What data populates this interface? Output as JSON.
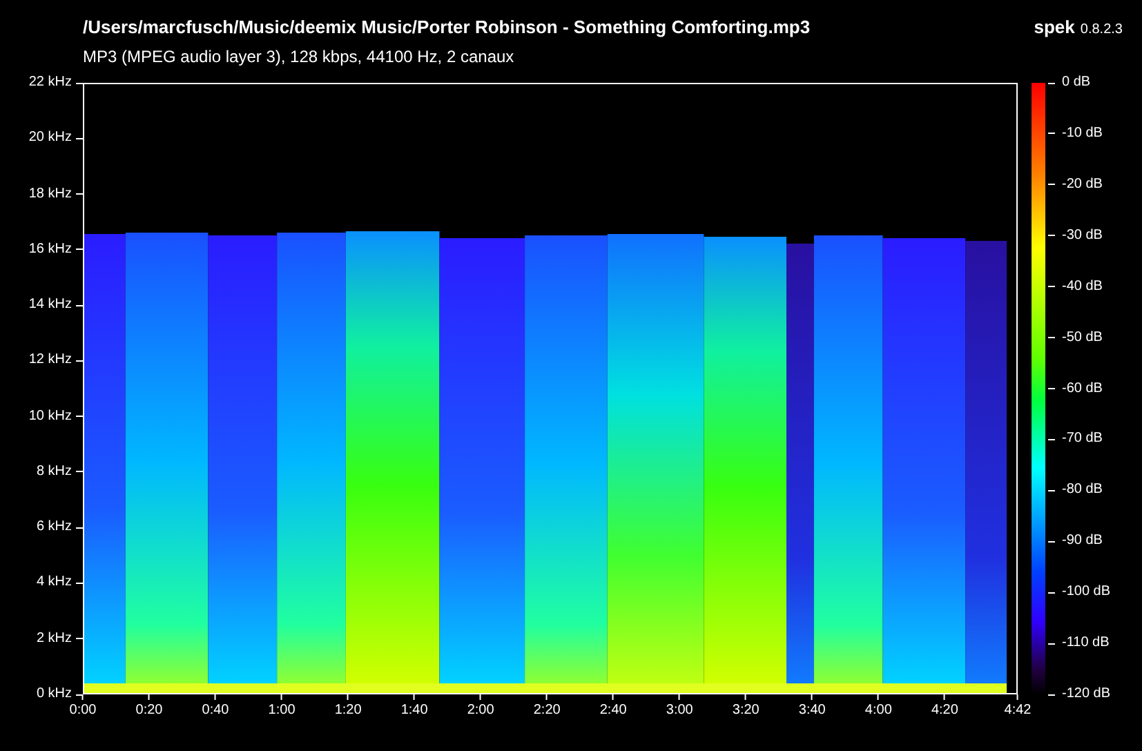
{
  "header": {
    "title": "/Users/marcfusch/Music/deemix Music/Porter Robinson - Something Comforting.mp3",
    "subtitle": "MP3 (MPEG audio layer 3), 128 kbps, 44100 Hz, 2 canaux",
    "brand": "spek",
    "version": "0.8.2.3"
  },
  "y_axis": {
    "ticks": [
      "22 kHz",
      "20 kHz",
      "18 kHz",
      "16 kHz",
      "14 kHz",
      "12 kHz",
      "10 kHz",
      "8 kHz",
      "6 kHz",
      "4 kHz",
      "2 kHz",
      "0 kHz"
    ]
  },
  "x_axis": {
    "ticks": [
      "0:00",
      "0:20",
      "0:40",
      "1:00",
      "1:20",
      "1:40",
      "2:00",
      "2:20",
      "2:40",
      "3:00",
      "3:20",
      "3:40",
      "4:00",
      "4:20",
      "4:42"
    ]
  },
  "colorbar": {
    "ticks": [
      "0 dB",
      "-10 dB",
      "-20 dB",
      "-30 dB",
      "-40 dB",
      "-50 dB",
      "-60 dB",
      "-70 dB",
      "-80 dB",
      "-90 dB",
      "-100 dB",
      "-110 dB",
      "-120 dB"
    ]
  }
}
